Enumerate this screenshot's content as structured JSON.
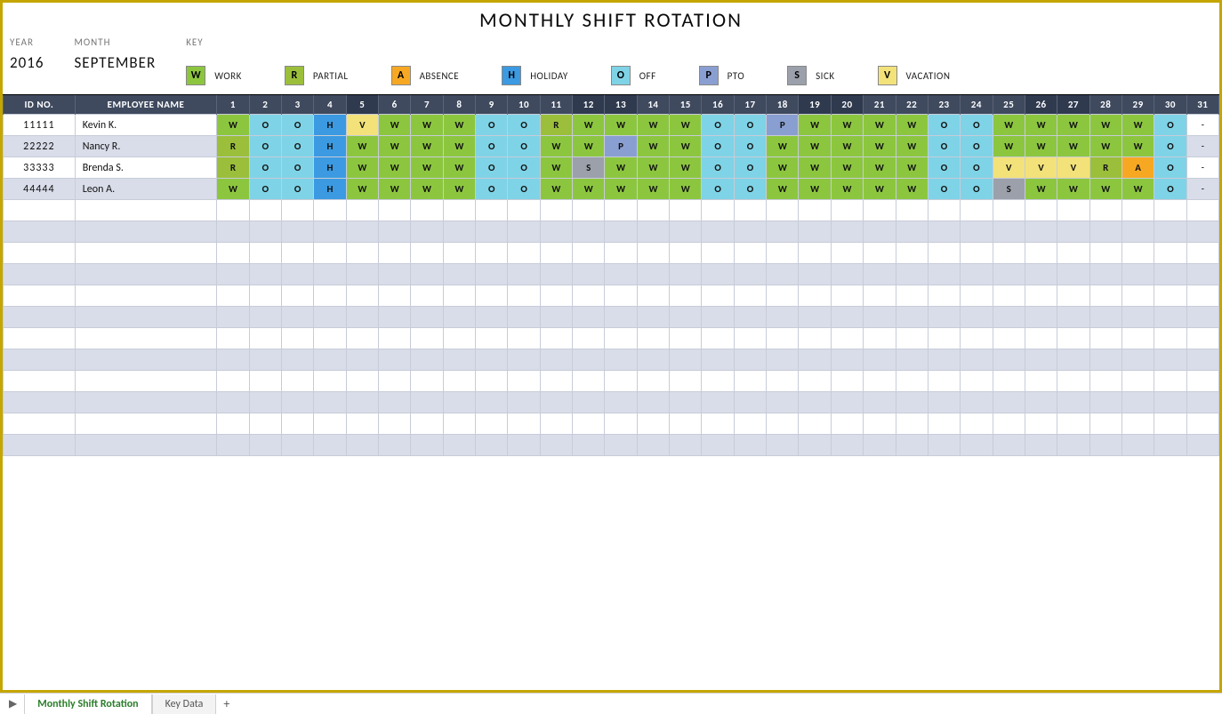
{
  "title": "MONTHLY SHIFT ROTATION",
  "labels": {
    "year": "YEAR",
    "month": "MONTH",
    "key": "KEY",
    "id": "ID NO.",
    "employee": "EMPLOYEE NAME"
  },
  "year": "2016",
  "month": "SEPTEMBER",
  "key": [
    {
      "code": "W",
      "label": "WORK",
      "color": "#8cc63f"
    },
    {
      "code": "R",
      "label": "PARTIAL",
      "color": "#9bbf3b"
    },
    {
      "code": "A",
      "label": "ABSENCE",
      "color": "#f7a823"
    },
    {
      "code": "H",
      "label": "HOLIDAY",
      "color": "#3b9ae1"
    },
    {
      "code": "O",
      "label": "OFF",
      "color": "#7fd3e6"
    },
    {
      "code": "P",
      "label": "PTO",
      "color": "#8a9fd1"
    },
    {
      "code": "S",
      "label": "SICK",
      "color": "#9ba0ab"
    },
    {
      "code": "V",
      "label": "VACATION",
      "color": "#f3e27a"
    }
  ],
  "days": [
    "1",
    "2",
    "3",
    "4",
    "5",
    "6",
    "7",
    "8",
    "9",
    "10",
    "11",
    "12",
    "13",
    "14",
    "15",
    "16",
    "17",
    "18",
    "19",
    "20",
    "21",
    "22",
    "23",
    "24",
    "25",
    "26",
    "27",
    "28",
    "29",
    "30",
    "31"
  ],
  "weekend_columns": [
    5,
    12,
    13,
    19,
    20,
    26,
    27
  ],
  "employees": [
    {
      "id": "11111",
      "name": "Kevin K.",
      "shifts": [
        "W",
        "O",
        "O",
        "H",
        "V",
        "W",
        "W",
        "W",
        "O",
        "O",
        "R",
        "W",
        "W",
        "W",
        "W",
        "O",
        "O",
        "P",
        "W",
        "W",
        "W",
        "W",
        "O",
        "O",
        "W",
        "W",
        "W",
        "W",
        "W",
        "O",
        "-"
      ]
    },
    {
      "id": "22222",
      "name": "Nancy R.",
      "shifts": [
        "R",
        "O",
        "O",
        "H",
        "W",
        "W",
        "W",
        "W",
        "O",
        "O",
        "W",
        "W",
        "P",
        "W",
        "W",
        "O",
        "O",
        "W",
        "W",
        "W",
        "W",
        "W",
        "O",
        "O",
        "W",
        "W",
        "W",
        "W",
        "W",
        "O",
        "-"
      ]
    },
    {
      "id": "33333",
      "name": "Brenda S.",
      "shifts": [
        "R",
        "O",
        "O",
        "H",
        "W",
        "W",
        "W",
        "W",
        "O",
        "O",
        "W",
        "S",
        "W",
        "W",
        "W",
        "O",
        "O",
        "W",
        "W",
        "W",
        "W",
        "W",
        "O",
        "O",
        "V",
        "V",
        "V",
        "R",
        "A",
        "O",
        "-"
      ]
    },
    {
      "id": "44444",
      "name": "Leon A.",
      "shifts": [
        "W",
        "O",
        "O",
        "H",
        "W",
        "W",
        "W",
        "W",
        "O",
        "O",
        "W",
        "W",
        "W",
        "W",
        "W",
        "O",
        "O",
        "W",
        "W",
        "W",
        "W",
        "W",
        "O",
        "O",
        "S",
        "W",
        "W",
        "W",
        "W",
        "O",
        "-"
      ]
    }
  ],
  "empty_rows": 12,
  "tabs": {
    "active": "Monthly Shift Rotation",
    "other": "Key Data",
    "add": "+"
  }
}
